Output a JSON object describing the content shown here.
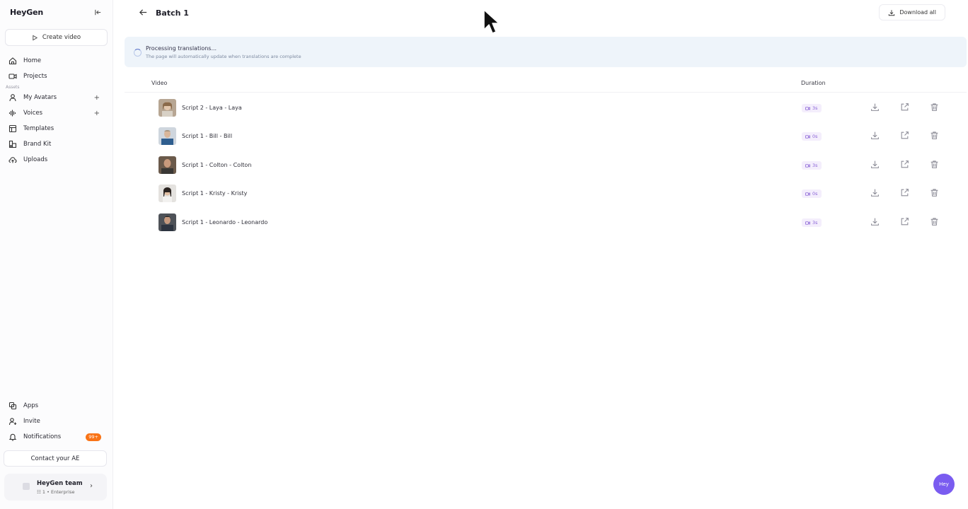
{
  "app": {
    "logo": "HeyGen",
    "create_video": "Create video"
  },
  "sidebar": {
    "main_items": [
      {
        "label": "Home",
        "icon": "home-icon"
      },
      {
        "label": "Projects",
        "icon": "video-camera-icon"
      }
    ],
    "section_label": "Assets",
    "asset_items": [
      {
        "label": "My Avatars",
        "icon": "user-icon",
        "has_plus": true
      },
      {
        "label": "Voices",
        "icon": "waveform-icon",
        "has_plus": true
      },
      {
        "label": "Templates",
        "icon": "template-icon"
      },
      {
        "label": "Brand Kit",
        "icon": "brand-kit-icon"
      },
      {
        "label": "Uploads",
        "icon": "cloud-upload-icon"
      }
    ],
    "bottom_items": [
      {
        "label": "Apps",
        "icon": "apps-icon"
      },
      {
        "label": "Invite",
        "icon": "user-plus-icon"
      },
      {
        "label": "Notifications",
        "icon": "bell-icon",
        "badge": "99+"
      }
    ],
    "contact": "Contact your AE",
    "team": {
      "name": "HeyGen team",
      "members": "1",
      "plan": "• Enterprise"
    }
  },
  "header": {
    "title": "Batch 1",
    "download_all": "Download all"
  },
  "banner": {
    "title": "Processing translations...",
    "subtitle": "The page will automatically update when translations are complete"
  },
  "table": {
    "columns": {
      "video": "Video",
      "duration": "Duration"
    },
    "rows": [
      {
        "title": "Script 2 - Laya - Laya",
        "duration": "3s"
      },
      {
        "title": "Script 1 - Bill - Bill",
        "duration": "0s"
      },
      {
        "title": "Script 1 - Colton - Colton",
        "duration": "3s"
      },
      {
        "title": "Script 1 - Kristy - Kristy",
        "duration": "0s"
      },
      {
        "title": "Script 1 - Leonardo - Leonardo",
        "duration": "3s"
      }
    ]
  },
  "chat": {
    "label": "Hey"
  },
  "colors": {
    "accent": "#7a5cf0",
    "badge": "#f97316",
    "banner_bg": "#eef4fa",
    "duration_text": "#8a64d6"
  }
}
